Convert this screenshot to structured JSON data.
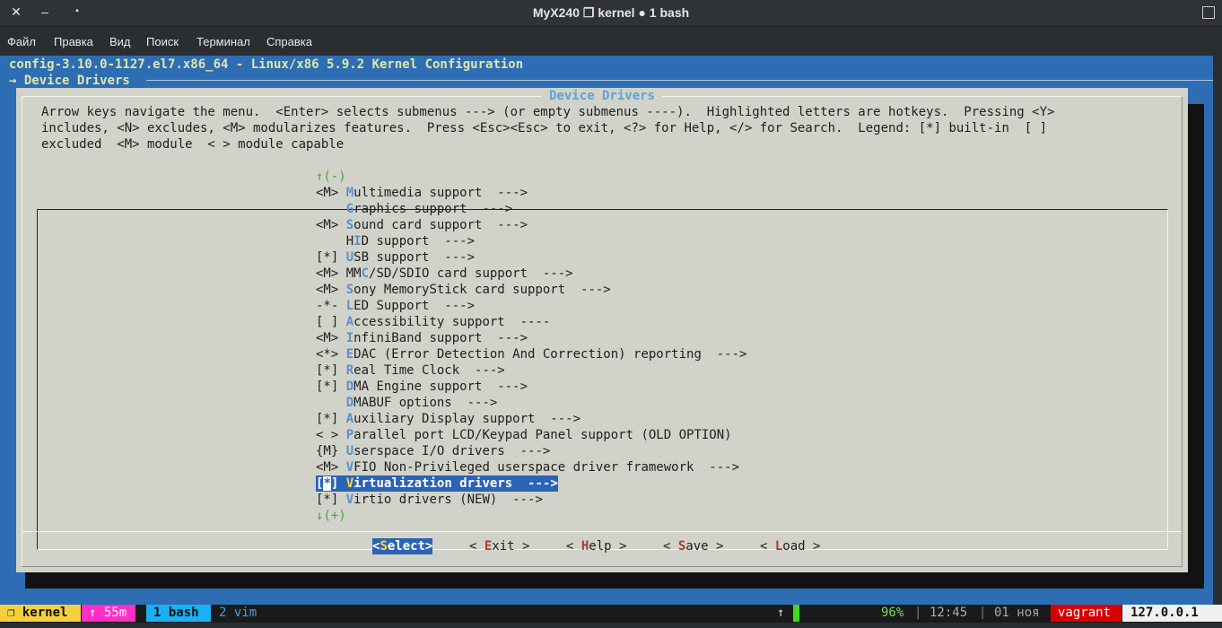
{
  "window": {
    "title": "MyX240 ❐ kernel ● 1 bash",
    "close_icon": "✕",
    "minimize_icon": "‒",
    "restore_icon": "▪"
  },
  "menubar": [
    "Файл",
    "Правка",
    "Вид",
    "Поиск",
    "Терминал",
    "Справка"
  ],
  "header": {
    "line1": "config-3.10.0-1127.el7.x86_64 - Linux/x86 5.9.2 Kernel Configuration",
    "line2": "→ Device Drivers"
  },
  "dialog": {
    "title": "Device Drivers",
    "help_lines": [
      "Arrow keys navigate the menu.  <Enter> selects submenus ---> (or empty submenus ----).  Highlighted letters are hotkeys.  Pressing <Y>",
      "includes, <N> excludes, <M> modularizes features.  Press <Esc><Esc> to exit, <?> for Help, </> for Search.  Legend: [*] built-in  [ ]",
      "excluded  <M> module  < > module capable"
    ],
    "scroll_up": "↑(-)",
    "scroll_down": "↓(+)",
    "items": [
      {
        "prefix": "<M> ",
        "hotkey": "M",
        "rest": "ultimedia support  --->"
      },
      {
        "prefix": "    ",
        "hotkey": "G",
        "rest": "raphics support  --->"
      },
      {
        "prefix": "<M> ",
        "hotkey": "S",
        "rest": "ound card support  --->"
      },
      {
        "prefix": "    H",
        "hotkey": "I",
        "rest": "D support  --->"
      },
      {
        "prefix": "[*] ",
        "hotkey": "U",
        "rest": "SB support  --->"
      },
      {
        "prefix": "<M> MM",
        "hotkey": "C",
        "rest": "/SD/SDIO card support  --->"
      },
      {
        "prefix": "<M> ",
        "hotkey": "S",
        "rest": "ony MemoryStick card support  --->"
      },
      {
        "prefix": "-*- ",
        "hotkey": "L",
        "rest": "ED Support  --->"
      },
      {
        "prefix": "[ ] ",
        "hotkey": "A",
        "rest": "ccessibility support  ----"
      },
      {
        "prefix": "<M> ",
        "hotkey": "I",
        "rest": "nfiniBand support  --->"
      },
      {
        "prefix": "<*> ",
        "hotkey": "E",
        "rest": "DAC (Error Detection And Correction) reporting  --->"
      },
      {
        "prefix": "[*] ",
        "hotkey": "R",
        "rest": "eal Time Clock  --->"
      },
      {
        "prefix": "[*] ",
        "hotkey": "D",
        "rest": "MA Engine support  --->"
      },
      {
        "prefix": "    ",
        "hotkey": "D",
        "rest": "MABUF options  --->"
      },
      {
        "prefix": "[*] ",
        "hotkey": "A",
        "rest": "uxiliary Display support  --->"
      },
      {
        "prefix": "< > ",
        "hotkey": "P",
        "rest": "arallel port LCD/Keypad Panel support (OLD OPTION)"
      },
      {
        "prefix": "{M} ",
        "hotkey": "U",
        "rest": "serspace I/O drivers  --->"
      },
      {
        "prefix": "<M> ",
        "hotkey": "V",
        "rest": "FIO Non-Privileged userspace driver framework  --->"
      },
      {
        "prefix": "[*] ",
        "hotkey": "V",
        "rest": "irtualization drivers  --->",
        "selected": true
      },
      {
        "prefix": "[*] ",
        "hotkey": "V",
        "rest": "irtio drivers (NEW)  --->"
      }
    ],
    "selected_prefix": {
      "open": "[",
      "cursor": "*",
      "close": "] "
    },
    "buttons": [
      {
        "pre": "<",
        "hotkey": "S",
        "post": "elect>",
        "active": true
      },
      {
        "pre": "< ",
        "hotkey": "E",
        "post": "xit >"
      },
      {
        "pre": "< ",
        "hotkey": "H",
        "post": "elp >"
      },
      {
        "pre": "< ",
        "hotkey": "S",
        "post": "ave >"
      },
      {
        "pre": "< ",
        "hotkey": "L",
        "post": "oad >"
      }
    ]
  },
  "statusbar": {
    "session": "❐ kernel",
    "uptime": "↑ 55m",
    "win_active": "1 bash",
    "win_other": "2 vim",
    "load_arrow": "↑",
    "battery_pct": "96%",
    "battery_level": 0.96,
    "sep1": "|",
    "time": "12:45",
    "sep2": "|",
    "date": "01 ноя",
    "user": "vagrant",
    "host": "127.0.0.1",
    "colors": {
      "session": "#f4d03f",
      "uptime": "#ff2ec4",
      "win_active": "#1ab0f5",
      "user": "#d70000",
      "host": "#f0f0f0"
    }
  }
}
